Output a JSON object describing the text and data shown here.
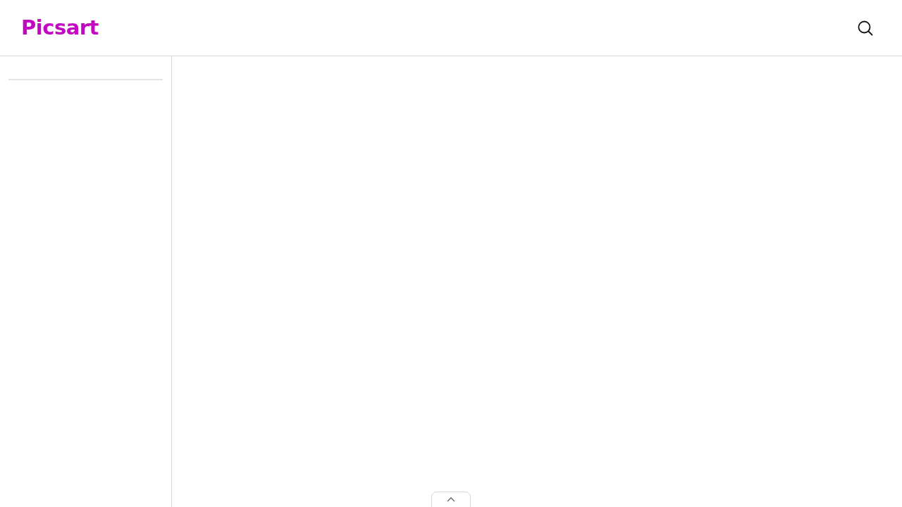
{
  "header": {
    "logo": "Picsart"
  }
}
